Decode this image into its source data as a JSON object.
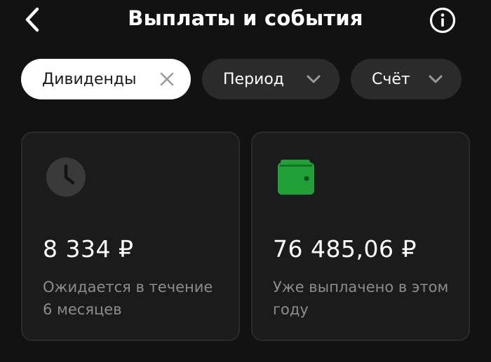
{
  "header": {
    "title": "Выплаты и события",
    "back_icon": "chevron-left-icon",
    "info_icon": "info-icon"
  },
  "filters": [
    {
      "label": "Дивиденды",
      "active": true,
      "icon": "close-icon"
    },
    {
      "label": "Период",
      "active": false,
      "icon": "chevron-down-icon"
    },
    {
      "label": "Счёт",
      "active": false,
      "icon": "chevron-down-icon"
    }
  ],
  "cards": {
    "expected": {
      "amount": "8 334 ₽",
      "description": "Ожидается в течение 6 месяцев",
      "icon": "clock-icon"
    },
    "paid": {
      "amount": "76 485,06 ₽",
      "description": "Уже выплачено в этом году",
      "icon": "wallet-icon"
    }
  },
  "colors": {
    "background": "#121212",
    "card_background": "#1b1b1b",
    "chip_active": "#ffffff",
    "chip_inactive": "#2b2b2b",
    "muted_text": "#8c8c8c",
    "wallet_green": "#21a038",
    "clock_gray": "#3a3a3a"
  }
}
